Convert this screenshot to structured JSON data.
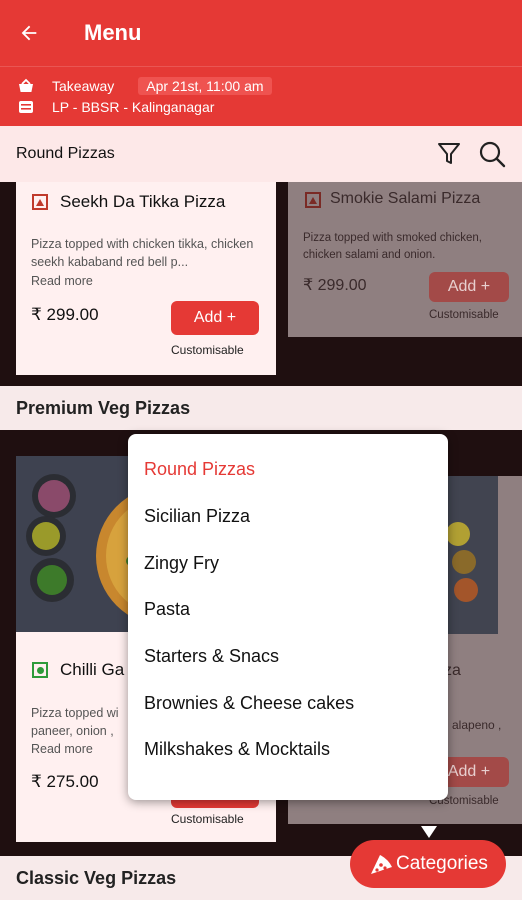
{
  "header": {
    "title": "Menu"
  },
  "order_info": {
    "mode": "Takeaway",
    "datetime": "Apr 21st, 11:00 am",
    "store": "LP - BBSR - Kalinganagar"
  },
  "category_header": {
    "title": "Round Pizzas"
  },
  "cards": [
    {
      "name": "Seekh Da Tikka Pizza",
      "desc": "Pizza topped with chicken tikka, chicken seekh kababand red bell p...",
      "read_more": "Read more",
      "price": "₹ 299.00",
      "add": "Add +",
      "customisable": "Customisable"
    },
    {
      "name": "Smokie Salami Pizza",
      "desc": "Pizza topped with smoked chicken, chicken salami and onion.",
      "price": "₹ 299.00",
      "add": "Add +",
      "customisable": "Customisable"
    },
    {
      "name": "Chilli Ga",
      "desc": "Pizza topped wi",
      "desc2": "paneer, onion ,",
      "read_more": "Read more",
      "price": "₹ 275.00",
      "add": "Add +",
      "customisable": "Customisable"
    },
    {
      "name": "za",
      "desc": "alapeno ,",
      "add": "Add +",
      "customisable": "Customisable"
    }
  ],
  "sections": {
    "premium_veg": "Premium Veg Pizzas",
    "classic_veg": "Classic Veg Pizzas"
  },
  "dropdown": {
    "items": [
      "Round Pizzas",
      "Sicilian Pizza",
      "Zingy Fry",
      "Pasta",
      "Starters & Snacs",
      "Brownies & Cheese cakes",
      "Milkshakes & Mocktails"
    ],
    "active_index": 0
  },
  "categories_button": {
    "label": "Categories"
  },
  "colors": {
    "primary": "#e53935",
    "card_bg": "#fff0f0",
    "veg": "#2e9b3a",
    "nonveg": "#c0392b"
  }
}
